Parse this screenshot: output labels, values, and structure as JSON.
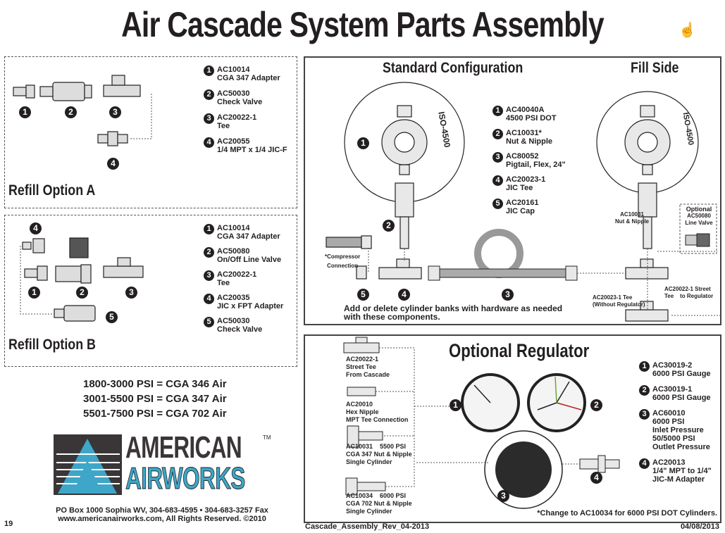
{
  "title": "Air Cascade System Parts Assembly",
  "cursor_icon": "hand-pointer-icon",
  "refill_a": {
    "title": "Refill Option A",
    "parts": [
      {
        "n": "1",
        "code": "AC10014",
        "desc": "CGA 347 Adapter"
      },
      {
        "n": "2",
        "code": "AC50030",
        "desc": "Check Valve"
      },
      {
        "n": "3",
        "code": "AC20022-1",
        "desc": "Tee"
      },
      {
        "n": "4",
        "code": "AC20055",
        "desc": "1/4 MPT x 1/4 JIC-F"
      }
    ]
  },
  "refill_b": {
    "title": "Refill Option B",
    "parts": [
      {
        "n": "1",
        "code": "AC10014",
        "desc": "CGA 347 Adapter"
      },
      {
        "n": "2",
        "code": "AC50080",
        "desc": "On/Off Line Valve"
      },
      {
        "n": "3",
        "code": "AC20022-1",
        "desc": "Tee"
      },
      {
        "n": "4",
        "code": "AC20035",
        "desc": "JIC x FPT Adapter"
      },
      {
        "n": "5",
        "code": "AC50030",
        "desc": "Check Valve"
      }
    ]
  },
  "standard": {
    "title": "Standard Configuration",
    "fill_side": "Fill Side",
    "cylinder_label": "ISO-4500",
    "parts": [
      {
        "n": "1",
        "code": "AC40040A",
        "desc": "4500 PSI DOT"
      },
      {
        "n": "2",
        "code": "AC10031*",
        "desc": "Nut & Nipple"
      },
      {
        "n": "3",
        "code": "AC80052",
        "desc": "Pigtail, Flex, 24\""
      },
      {
        "n": "4",
        "code": "AC20023-1",
        "desc": "JIC Tee"
      },
      {
        "n": "5",
        "code": "AC20161",
        "desc": "JIC Cap"
      }
    ],
    "compressor": [
      "*Compressor",
      "Connection"
    ],
    "note": [
      "Add or delete cylinder banks with hardware as needed",
      "with these components."
    ],
    "fill_nut": [
      "AC10031",
      "Nut & Nipple"
    ],
    "optional": [
      "Optional",
      "AC50080",
      "Line Valve"
    ],
    "street_tee": [
      "AC20022-1 Street",
      "Tee    to Regulator"
    ],
    "tee_no_reg": [
      "AC20023-1 Tee",
      "(Without Regulator)"
    ]
  },
  "regulator": {
    "title": "Optional Regulator",
    "parts": [
      {
        "n": "1",
        "lines": [
          "AC30019-2",
          "6000 PSI Gauge"
        ]
      },
      {
        "n": "2",
        "lines": [
          "AC30019-1",
          "6000 PSI Gauge"
        ]
      },
      {
        "n": "3",
        "lines": [
          "AC60010",
          "6000 PSI",
          "Inlet Pressure",
          "50/5000 PSI",
          "Outlet Pressure"
        ]
      },
      {
        "n": "4",
        "lines": [
          "AC20013",
          "1/4\" MPT to 1/4\"",
          "JIC-M Adapter"
        ]
      }
    ],
    "left_items": [
      [
        "AC20022-1",
        "Street Tee",
        "From Cascade"
      ],
      [
        "AC20010",
        "Hex Nipple",
        "MPT Tee Connection"
      ],
      [
        "AC10031    5500 PSI",
        "CGA 347 Nut & Nipple",
        "Single Cylinder"
      ],
      [
        "AC10034    6000 PSI",
        "CGA 702 Nut & Nipple",
        "Single Cylinder"
      ]
    ],
    "footnote": "*Change to AC10034 for 6000 PSI DOT Cylinders."
  },
  "psi_table": [
    "1800-3000 PSI = CGA 346 Air",
    "3001-5500 PSI = CGA 347 Air",
    "5501-7500 PSI = CGA 702 Air"
  ],
  "logo": {
    "line1": "AMERICAN",
    "line2": "AIRWORKS",
    "tm": "TM",
    "colors": {
      "dark": "#3a3536",
      "blue": "#3ea6c8"
    }
  },
  "address": [
    "PO Box 1000 Sophia WV, 304-683-4595 • 304-683-3257 Fax",
    "www.americanairworks.com, All Rights Reserved. ©2010"
  ],
  "footer": {
    "page": "19",
    "file": "Cascade_Assembly_Rev_04-2013",
    "date": "04/08/2013"
  }
}
